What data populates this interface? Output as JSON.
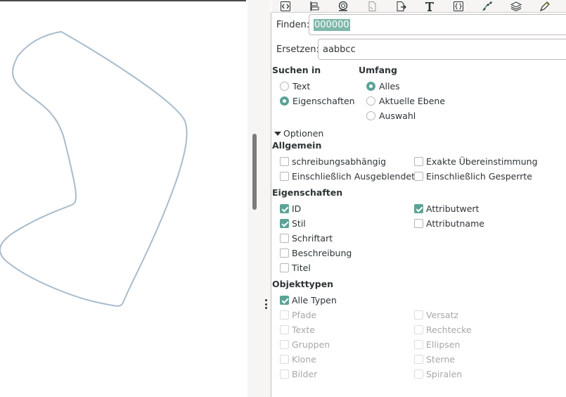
{
  "toolbar": {
    "icons": [
      "xml-editor-icon",
      "align-icon",
      "fill-stroke-icon",
      "document-properties-icon",
      "export-icon",
      "text-icon",
      "object-properties-icon",
      "path-effects-icon",
      "layers-icon",
      "pen-icon"
    ]
  },
  "search": {
    "find_label": "Finden:",
    "find_value": "000000",
    "replace_label": "Ersetzen:",
    "replace_value": "aabbcc"
  },
  "search_in": {
    "heading": "Suchen in",
    "options": [
      {
        "label": "Text",
        "checked": false
      },
      {
        "label": "Eigenschaften",
        "checked": true
      }
    ]
  },
  "scope": {
    "heading": "Umfang",
    "options": [
      {
        "label": "Alles",
        "checked": true
      },
      {
        "label": "Aktuelle Ebene",
        "checked": false
      },
      {
        "label": "Auswahl",
        "checked": false
      }
    ]
  },
  "options_toggle": "Optionen",
  "general": {
    "heading": "Allgemein",
    "items": [
      {
        "label": "schreibungsabhängig",
        "checked": false
      },
      {
        "label": "Exakte Übereinstimmung",
        "checked": false
      },
      {
        "label": "Einschließlich Ausgeblendete",
        "checked": false
      },
      {
        "label": "Einschließlich Gesperrte",
        "checked": false
      }
    ]
  },
  "properties": {
    "heading": "Eigenschaften",
    "items": [
      {
        "label": "ID",
        "checked": true
      },
      {
        "label": "Attributwert",
        "checked": true
      },
      {
        "label": "Stil",
        "checked": true
      },
      {
        "label": "Attributname",
        "checked": false
      },
      {
        "label": "Schriftart",
        "checked": false
      },
      {
        "label": "Beschreibung",
        "checked": false
      },
      {
        "label": "Titel",
        "checked": false
      }
    ]
  },
  "object_types": {
    "heading": "Objekttypen",
    "all": {
      "label": "Alle Typen",
      "checked": true
    },
    "items": [
      {
        "label": "Pfade",
        "checked": false
      },
      {
        "label": "Versatz",
        "checked": false
      },
      {
        "label": "Texte",
        "checked": false
      },
      {
        "label": "Rechtecke",
        "checked": false
      },
      {
        "label": "Gruppen",
        "checked": false
      },
      {
        "label": "Ellipsen",
        "checked": false
      },
      {
        "label": "Klone",
        "checked": false
      },
      {
        "label": "Sterne",
        "checked": false
      },
      {
        "label": "Bilder",
        "checked": false
      },
      {
        "label": "Spiralen",
        "checked": false
      }
    ]
  },
  "colors": {
    "accent": "#5ca397",
    "selection": "#7fb8ab",
    "shape_stroke": "#a9bccb"
  }
}
